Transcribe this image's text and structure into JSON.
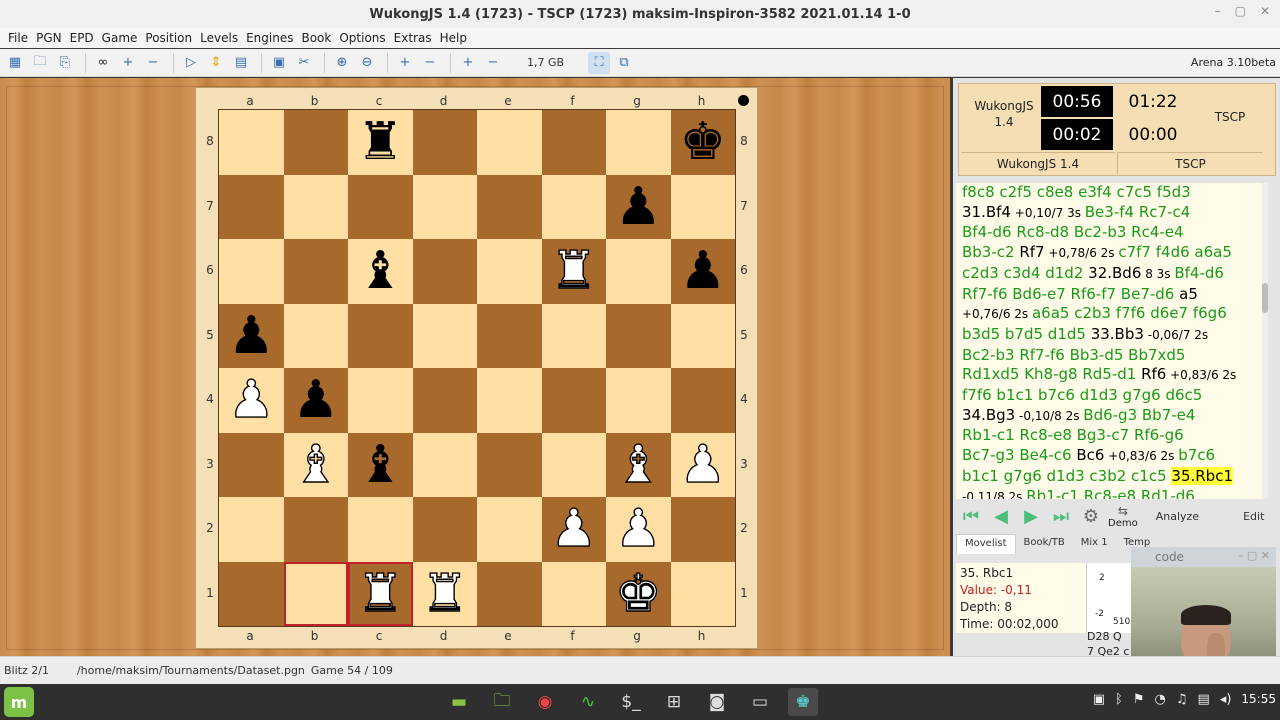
{
  "window": {
    "title": "WukongJS 1.4 (1723)  - TSCP (1723)    maksim-Inspiron-3582    2021.01.14    1-0",
    "controls": [
      "–",
      "▢",
      "✕"
    ]
  },
  "menu": [
    "File",
    "PGN",
    "EPD",
    "Game",
    "Position",
    "Levels",
    "Engines",
    "Book",
    "Options",
    "Extras",
    "Help"
  ],
  "toolbar": {
    "memory": "1,7 GB",
    "version": "Arena 3.10beta"
  },
  "board": {
    "files": [
      "a",
      "b",
      "c",
      "d",
      "e",
      "f",
      "g",
      "h"
    ],
    "ranks": [
      "8",
      "7",
      "6",
      "5",
      "4",
      "3",
      "2",
      "1"
    ],
    "squares": [
      [
        "",
        "",
        "b-r",
        "",
        "",
        "",
        "",
        "b-k"
      ],
      [
        "",
        "",
        "",
        "",
        "",
        "",
        "b-p",
        ""
      ],
      [
        "",
        "",
        "b-b",
        "",
        "",
        "w-r",
        "",
        "b-p"
      ],
      [
        "b-p",
        "",
        "",
        "",
        "",
        "",
        "",
        ""
      ],
      [
        "w-p",
        "b-p",
        "",
        "",
        "",
        "",
        "",
        ""
      ],
      [
        "",
        "w-b",
        "b-b",
        "",
        "",
        "",
        "w-b",
        "w-p"
      ],
      [
        "",
        "",
        "",
        "",
        "",
        "w-p",
        "w-p",
        ""
      ],
      [
        "",
        "",
        "w-r",
        "w-r",
        "",
        "",
        "w-k",
        ""
      ]
    ],
    "highlighted": [
      "b1",
      "c1"
    ],
    "side_to_move": "black"
  },
  "clock": {
    "white_name": "WukongJS 1.4",
    "white_time": "00:56",
    "white_move_time": "00:02",
    "black_name": "TSCP",
    "black_time": "01:22",
    "black_move_time": "00:00",
    "white_footer": "WukongJS 1.4",
    "black_footer": "TSCP"
  },
  "movelist": {
    "rows": [
      [
        {
          "t": "f8c8 c2f5 c8e8 e3f4 c7c5 f5d3",
          "c": "g"
        }
      ],
      [
        {
          "t": "31.Bf4",
          "c": "b"
        },
        {
          "t": " +0,10/7 3s ",
          "c": "e"
        },
        {
          "t": "Be3-f4 Rc7-c4",
          "c": "g"
        }
      ],
      [
        {
          "t": "Bf4-d6 Rc8-d8 Bc2-b3 Rc4-e4",
          "c": "g"
        }
      ],
      [
        {
          "t": "Bb3-c2 ",
          "c": "g"
        },
        {
          "t": "Rf7",
          "c": "b"
        },
        {
          "t": " +0,78/6 2s ",
          "c": "e"
        },
        {
          "t": "c7f7 f4d6 a6a5",
          "c": "g"
        }
      ],
      [
        {
          "t": "c2d3 c3d4 d1d2 ",
          "c": "g"
        },
        {
          "t": "32.Bd6",
          "c": "b"
        },
        {
          "t": " 8 3s ",
          "c": "e"
        },
        {
          "t": "Bf4-d6",
          "c": "g"
        }
      ],
      [
        {
          "t": "Rf7-f6 Bd6-e7 Rf6-f7 Be7-d6 ",
          "c": "g"
        },
        {
          "t": "a5",
          "c": "b"
        }
      ],
      [
        {
          "t": "+0,76/6 2s ",
          "c": "e"
        },
        {
          "t": "a6a5 c2b3 f7f6 d6e7 f6g6",
          "c": "g"
        }
      ],
      [
        {
          "t": "b3d5 b7d5 d1d5 ",
          "c": "g"
        },
        {
          "t": "33.Bb3",
          "c": "b"
        },
        {
          "t": " -0,06/7 2s",
          "c": "e"
        }
      ],
      [
        {
          "t": "Bc2-b3 Rf7-f6 Bb3-d5 Bb7xd5",
          "c": "g"
        }
      ],
      [
        {
          "t": "Rd1xd5 Kh8-g8 Rd5-d1 ",
          "c": "g"
        },
        {
          "t": "Rf6",
          "c": "b"
        },
        {
          "t": " +0,83/6 2s",
          "c": "e"
        }
      ],
      [
        {
          "t": "f7f6 b1c1 b7c6 d1d3 g7g6 d6c5",
          "c": "g"
        }
      ],
      [
        {
          "t": "34.Bg3",
          "c": "b"
        },
        {
          "t": " -0,10/8 2s ",
          "c": "e"
        },
        {
          "t": "Bd6-g3 Bb7-e4",
          "c": "g"
        }
      ],
      [
        {
          "t": "Rb1-c1 Rc8-e8 Bg3-c7 Rf6-g6",
          "c": "g"
        }
      ],
      [
        {
          "t": "Bc7-g3 Be4-c6 ",
          "c": "g"
        },
        {
          "t": "Bc6",
          "c": "b"
        },
        {
          "t": " +0,83/6 2s ",
          "c": "e"
        },
        {
          "t": "b7c6",
          "c": "g"
        }
      ],
      [
        {
          "t": "b1c1 g7g6 d1d3 c3b2 c1c5 ",
          "c": "g"
        },
        {
          "t": "35.Rbc1",
          "c": "cur"
        }
      ],
      [
        {
          "t": "-0,11/8 2s ",
          "c": "e"
        },
        {
          "t": "Rb1-c1 Rc8-e8 Rd1-d6",
          "c": "g"
        }
      ]
    ]
  },
  "nav": {
    "demo": "Demo",
    "analyze": "Analyze",
    "edit": "Edit"
  },
  "tabs": [
    "Movelist",
    "Book/TB",
    "Mix 1",
    "Temp"
  ],
  "info": {
    "move": "35. Rbc1",
    "value": "Value: -0,11",
    "depth": "Depth: 8",
    "time": "Time: 00:02,000"
  },
  "graph": {
    "labels": [
      "2",
      "-2",
      "510"
    ],
    "lines": [
      "D28 Q",
      "7 Qe2 c"
    ]
  },
  "webcam": {
    "title": "code"
  },
  "status": {
    "mode": "Blitz 2/1",
    "path": "/home/maksim/Tournaments/Dataset.pgn",
    "game": "Game 54 / 109"
  },
  "taskbar": {
    "clock": "15:55"
  },
  "colors": {
    "light_square": "#ffdfa4",
    "dark_square": "#a86a2c",
    "move_green": "#1a9a1a",
    "current_move_bg": "#ffff33",
    "value_red": "#c02020"
  }
}
